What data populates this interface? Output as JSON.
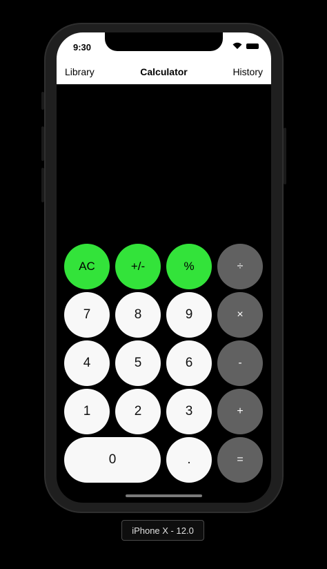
{
  "status": {
    "time": "9:30"
  },
  "nav": {
    "left": "Library",
    "title": "Calculator",
    "right": "History"
  },
  "keys": [
    [
      "AC",
      "+/-",
      "%",
      "÷"
    ],
    [
      "7",
      "8",
      "9",
      "×"
    ],
    [
      "4",
      "5",
      "6",
      "-"
    ],
    [
      "1",
      "2",
      "3",
      "+"
    ],
    [
      "0",
      ".",
      "="
    ]
  ],
  "colors": {
    "function_key": "#33e33a",
    "digit_key": "#f8f8f8",
    "operator_key": "#616161"
  },
  "device_label": "iPhone X - 12.0"
}
